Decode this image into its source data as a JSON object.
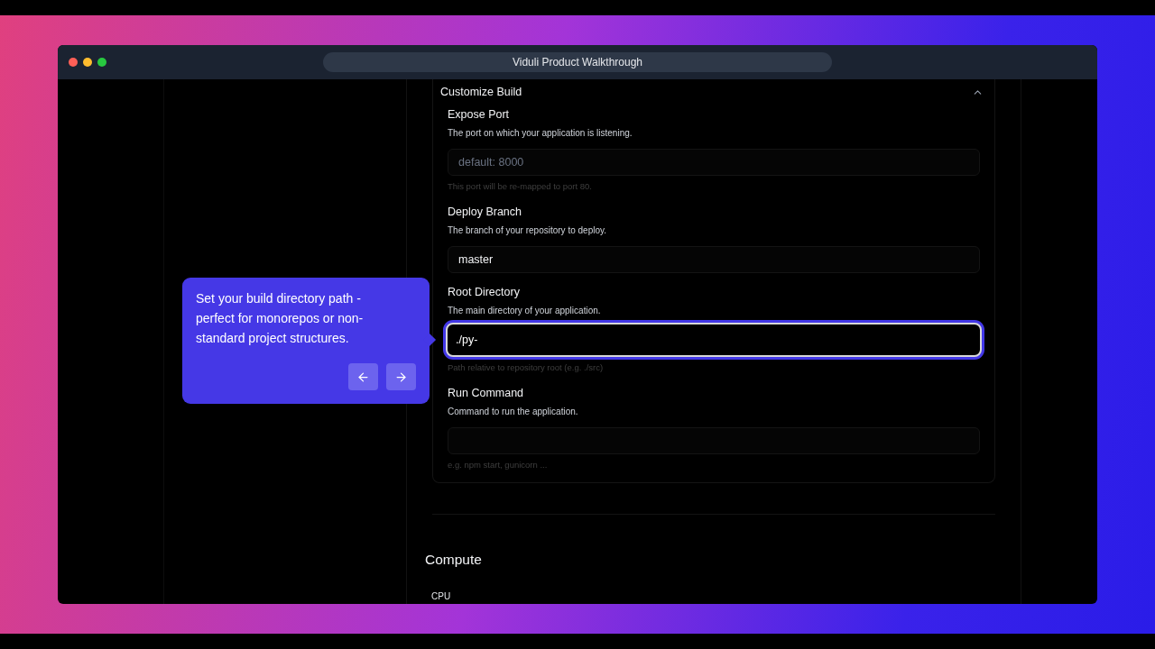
{
  "window": {
    "title": "Viduli Product Walkthrough"
  },
  "section": {
    "title": "Customize Build",
    "expanded": true
  },
  "fields": [
    {
      "label": "Expose Port",
      "description": "The port on which your application is listening.",
      "placeholder": "default: 8000",
      "hint": "This port will be re-mapped to port 80.",
      "focused": false
    },
    {
      "label": "Deploy Branch",
      "description": "The branch of your repository to deploy.",
      "value": "master",
      "focused": false
    },
    {
      "label": "Root Directory",
      "description": "The main directory of your application.",
      "value": "./py-",
      "hint": "Path relative to repository root (e.g. ./src)",
      "focused": true
    },
    {
      "label": "Run Command",
      "description": "Command to run the application.",
      "hint": "e.g. npm start, gunicorn ...",
      "focused": false
    }
  ],
  "compute": {
    "title": "Compute",
    "subtitle": "CPU"
  },
  "tour": {
    "text": "Set your build directory path - perfect for monorepos or non-standard project structures."
  }
}
